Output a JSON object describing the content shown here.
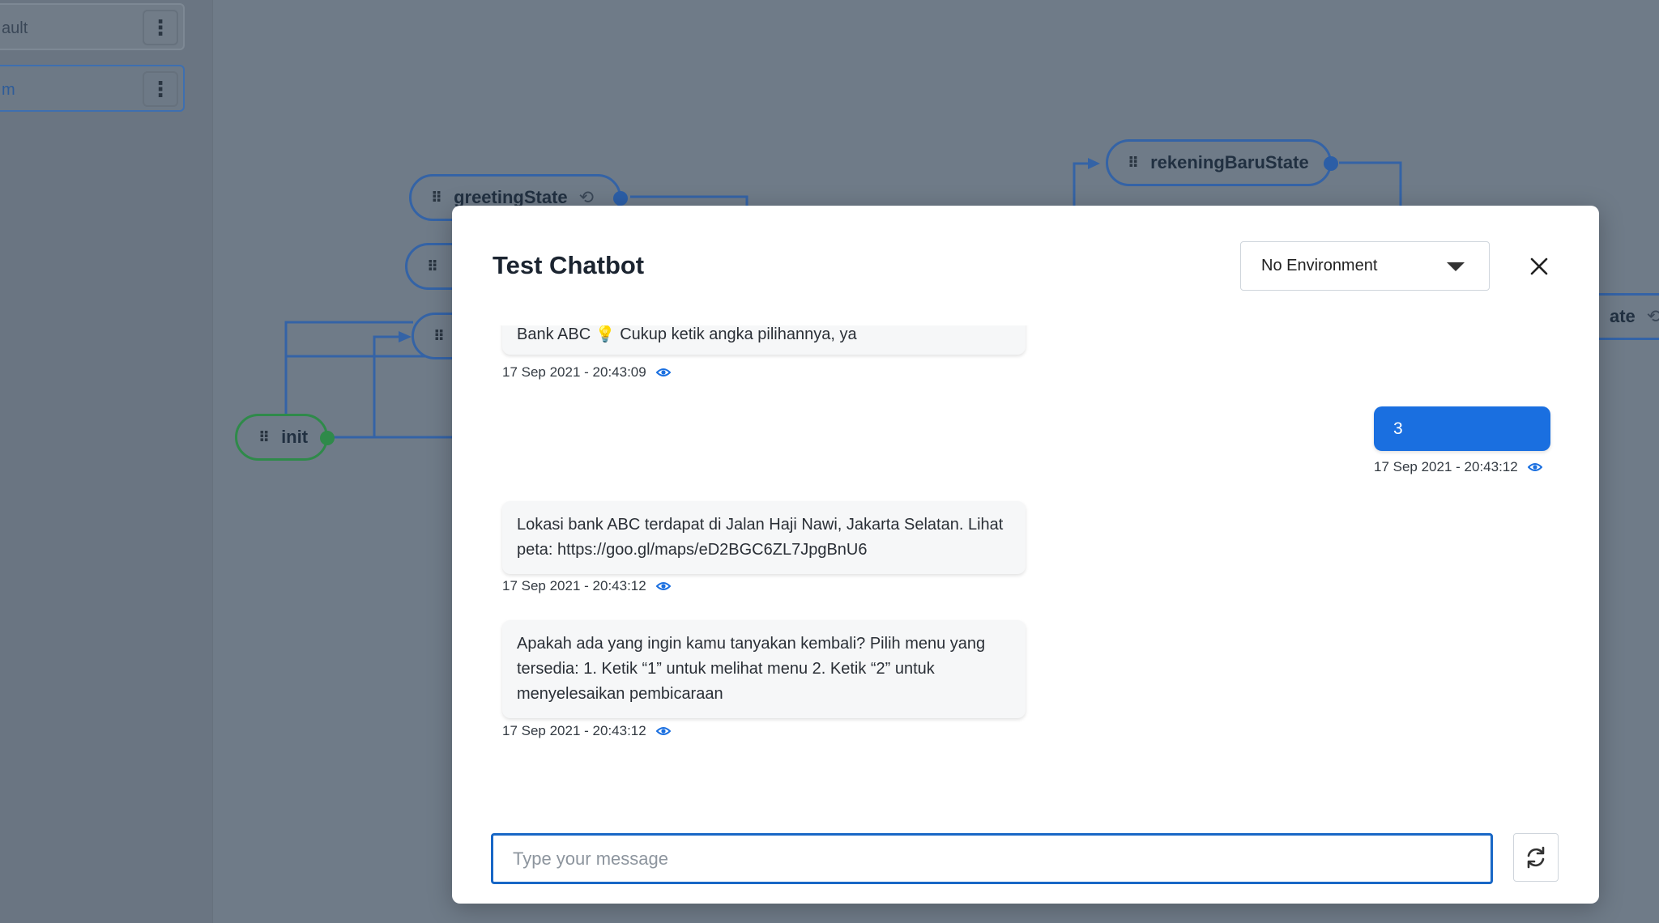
{
  "sidebar": {
    "items": [
      {
        "label": "ault"
      },
      {
        "label": "m"
      }
    ]
  },
  "flow": {
    "nodes": {
      "greeting": "greetingState",
      "rekening": "rekeningBaruState",
      "init": "init",
      "partial_right": "ate"
    }
  },
  "modal": {
    "title": "Test Chatbot",
    "environment": "No Environment",
    "messages": [
      {
        "sender": "bot",
        "text_pre": "Bank ABC",
        "text_post": "Cukup ketik angka pilihannya, ya",
        "time": "17 Sep 2021 - 20:43:09"
      },
      {
        "sender": "user",
        "text": "3",
        "time": "17 Sep 2021 - 20:43:12"
      },
      {
        "sender": "bot",
        "text": "Lokasi bank ABC terdapat di Jalan Haji Nawi, Jakarta Selatan. Lihat peta: https://goo.gl/maps/eD2BGC6ZL7JpgBnU6",
        "time": "17 Sep 2021 - 20:43:12"
      },
      {
        "sender": "bot",
        "text": "Apakah ada yang ingin kamu tanyakan kembali? Pilih menu yang tersedia: 1. Ketik “1” untuk melihat menu 2. Ketik “2” untuk menyelesaikan pembicaraan",
        "time": "17 Sep 2021 - 20:43:12"
      }
    ],
    "input": {
      "placeholder": "Type your message",
      "value": ""
    }
  },
  "icons": {
    "close": "close-icon",
    "caret": "chevron-down-icon",
    "eye": "eye-icon",
    "refresh": "refresh-icon",
    "grip": "drag-handle-icon",
    "kebab": "kebab-menu-icon",
    "bulb": "lightbulb-icon"
  },
  "colors": {
    "accent": "#1a6fe0",
    "input_border": "#1867c6",
    "node_blue": "#3463a6",
    "node_green": "#2f8a4a"
  }
}
